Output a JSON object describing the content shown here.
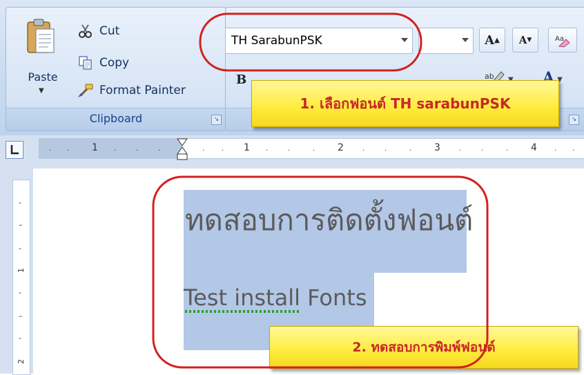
{
  "clipboard": {
    "paste_label": "Paste",
    "cut_label": "Cut",
    "copy_label": "Copy",
    "format_painter_label": "Format Painter",
    "group_label": "Clipboard"
  },
  "font": {
    "font_name": "TH SarabunPSK",
    "font_size": "",
    "bold_label": "B",
    "grow_font_label": "A",
    "shrink_font_label": "A",
    "font_color_label": "A",
    "font_color": "#ff0000",
    "highlight_color": "#ffff00"
  },
  "ruler": {
    "marks": [
      "1",
      "1",
      "2",
      "3",
      "4"
    ],
    "vertical_marks": [
      "1",
      "2"
    ]
  },
  "document": {
    "thai_heading": "ทดสอบการติดตั้งฟอนต์",
    "english_line": "Test install Fonts",
    "selection_color": "#b3c7e7"
  },
  "annotations": {
    "callout_1": "1. เลือกฟอนต์ TH sarabunPSK",
    "callout_2": "2. ทดสอบการพิมพ์ฟอนต์",
    "circle_color": "#d32020",
    "callout_color": "#ffeb3b"
  },
  "icons": [
    "clipboard-icon",
    "scissors-icon",
    "copy-icon",
    "format-painter-icon",
    "clear-formatting-icon",
    "highlighter-icon",
    "tab-stop-icon",
    "indent-marker-icon"
  ]
}
